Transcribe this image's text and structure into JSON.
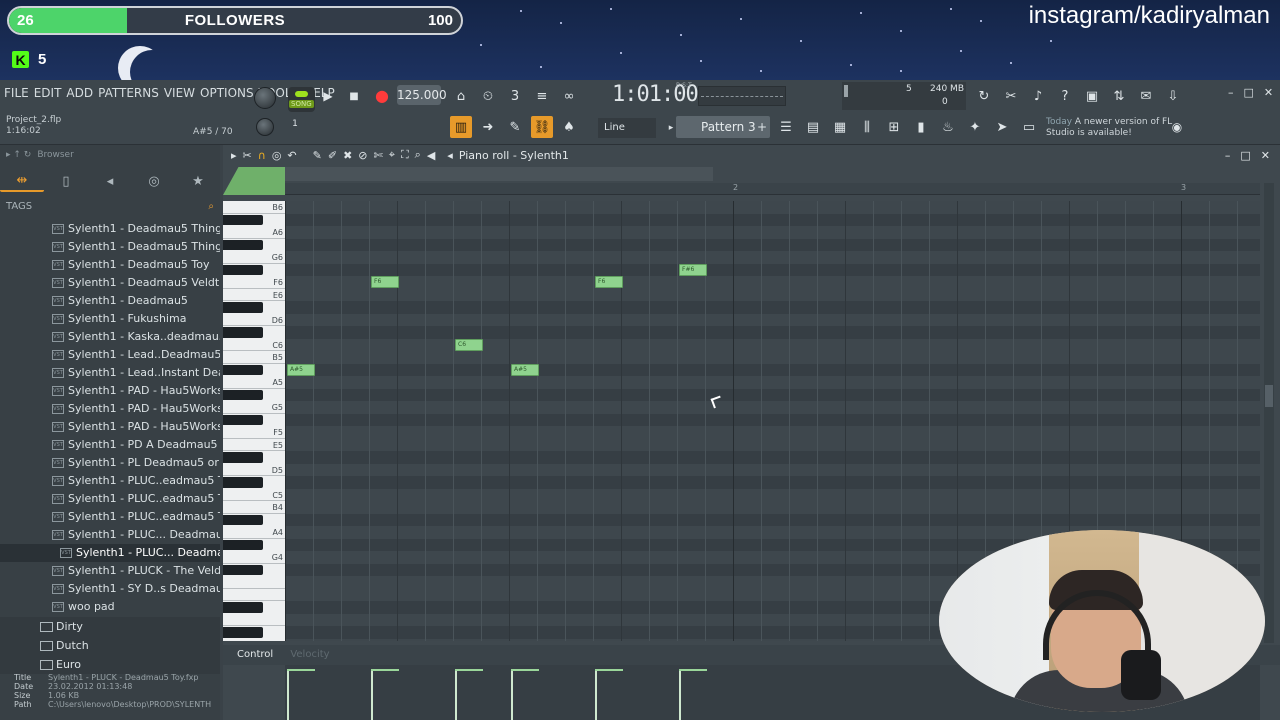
{
  "overlay": {
    "followers_current": "26",
    "followers_label": "FOLLOWERS",
    "followers_goal": "100",
    "followers_progress": 0.26,
    "kick_count": "5",
    "instagram": "instagram/kadiryalman"
  },
  "menu": [
    "FILE",
    "EDIT",
    "ADD",
    "PATTERNS",
    "VIEW",
    "OPTIONS",
    "TOOLS",
    "HELP"
  ],
  "project": {
    "name": "Project_2.flp",
    "time": "1:16:02",
    "hint": "A#5 / 70"
  },
  "transport": {
    "song_label": "SONG",
    "tempo": "125.000",
    "time": "1:01:00",
    "time_sub": "B:S:T"
  },
  "memory": {
    "voices": "5",
    "ram": "240 MB",
    "cpu": "0"
  },
  "toolbar2": {
    "snap": "Line",
    "pattern": "Pattern 3"
  },
  "news": {
    "when": "Today",
    "text": "A newer version of FL Studio is available!"
  },
  "browser": {
    "title": "Browser",
    "tags_label": "TAGS",
    "items": [
      "Sylenth1 - Deadmau5 Thing 4",
      "Sylenth1 - Deadmau5 Thing",
      "Sylenth1 - Deadmau5 Toy",
      "Sylenth1 - Deadmau5 Veldt",
      "Sylenth1 - Deadmau5",
      "Sylenth1 - Fukushima",
      "Sylenth1 - Kaska..deadmau5 - Mov",
      "Sylenth1 - Lead..Deadmau5 revised",
      "Sylenth1 - Lead..Instant Deadmau5",
      "Sylenth1 - PAD - Hau5Works 1",
      "Sylenth1 - PAD - Hau5Works 2",
      "Sylenth1 - PAD - Hau5Works 3",
      "Sylenth1 - PD A Deadmau5  Chance",
      "Sylenth1 - PL Deadmau5 or Inpetto",
      "Sylenth1 - PLUC..eadmau5 Thing 1",
      "Sylenth1 - PLUC..eadmau5 Thing 2",
      "Sylenth1 - PLUC..eadmau5 Thing 3",
      "Sylenth1 - PLUC... Deadmau5 Toy 2",
      "Sylenth1 - PLUC... Deadmau5 Toy",
      "Sylenth1 - PLUCK - The Veldt",
      "Sylenth1 - SY D..s Deadmau5 Lead",
      "woo pad"
    ],
    "selected_index": 18,
    "folders": [
      "Dirty",
      "Dutch",
      "Euro"
    ],
    "info": {
      "title_label": "Title",
      "title": "Sylenth1 - PLUCK - Deadmau5 Toy.fxp",
      "date_label": "Date",
      "date": "23.02.2012 01:13:48",
      "size_label": "Size",
      "size": "1.06 KB",
      "path_label": "Path",
      "path": "C:\\Users\\lenovo\\Desktop\\PROD\\SYLENTH"
    }
  },
  "pianoroll": {
    "title": "Piano roll - Sylenth1",
    "bar_numbers": [
      "2",
      "3"
    ],
    "control_label": "Control",
    "control_value": "Velocity",
    "key_labels": [
      "B6",
      "A6",
      "G6",
      "F6",
      "E6",
      "D6",
      "C6",
      "B5",
      "A5",
      "G5",
      "F5",
      "E5",
      "D5",
      "C5",
      "B4",
      "A4",
      "G4"
    ],
    "notes": [
      {
        "label": "A#5",
        "step": 0,
        "len": 2,
        "pitch": "A#5"
      },
      {
        "label": "F6",
        "step": 6,
        "len": 2,
        "pitch": "F6"
      },
      {
        "label": "C6",
        "step": 12,
        "len": 2,
        "pitch": "C6"
      },
      {
        "label": "A#5",
        "step": 16,
        "len": 2,
        "pitch": "A#5"
      },
      {
        "label": "F6",
        "step": 22,
        "len": 2,
        "pitch": "F6"
      },
      {
        "label": "F#6",
        "step": 28,
        "len": 2,
        "pitch": "F#6"
      }
    ]
  }
}
